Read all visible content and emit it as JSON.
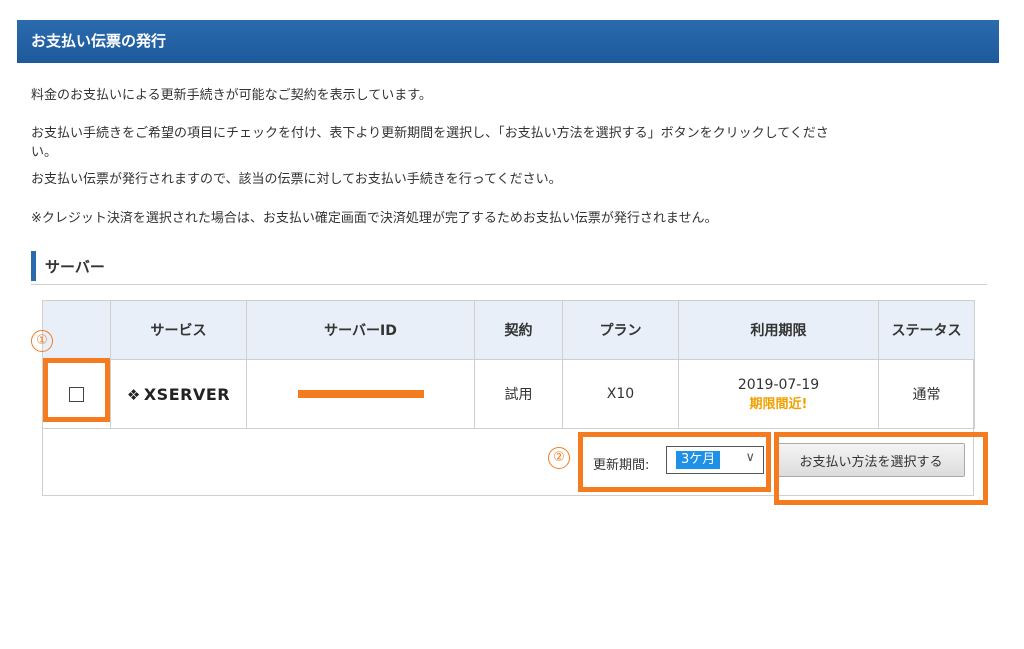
{
  "header": {
    "title": "お支払い伝票の発行"
  },
  "intro": {
    "line1": "料金のお支払いによる更新手続きが可能なご契約を表示しています。",
    "line2": "お支払い手続きをご希望の項目にチェックを付け、表下より更新期間を選択し、「お支払い方法を選択する」ボタンをクリックしてくださ",
    "line3": "い。",
    "line4": "お支払い伝票が発行されますので、該当の伝票に対してお支払い手続きを行ってください。",
    "line5": "※クレジット決済を選択された場合は、お支払い確定画面で決済処理が完了するためお支払い伝票が発行されません。"
  },
  "section": {
    "title": "サーバー"
  },
  "table": {
    "headers": [
      "",
      "サービス",
      "サーバーID",
      "契約",
      "プラン",
      "利用期限",
      "ステータス"
    ],
    "row": {
      "service_logo": "XSERVER",
      "contract": "試用",
      "plan": "X10",
      "expiry_date": "2019-07-19",
      "expiry_note": "期限間近!",
      "status": "通常"
    }
  },
  "footer": {
    "period_label": "更新期間:",
    "period_value": "3ケ月",
    "pay_button_label": "お支払い方法を選択する"
  },
  "annotations": {
    "marker1": "①",
    "marker2": "②",
    "color": "#f47b20"
  },
  "colors": {
    "header_bg": "#1d5a9c",
    "table_header_bg": "#e8eff8",
    "warning": "#f0a000"
  }
}
